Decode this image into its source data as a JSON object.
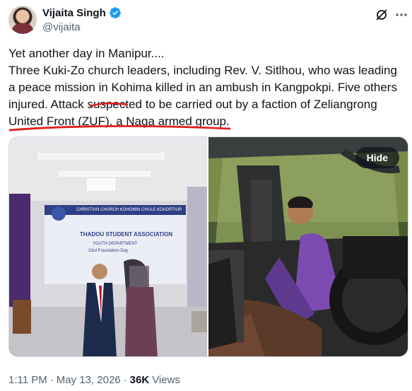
{
  "author": {
    "display_name": "Vijaita Singh",
    "handle": "@vijaita",
    "verified": true
  },
  "icons": {
    "verified": "verified-badge-icon",
    "grok": "grok-slash-icon",
    "more": "more-dots-icon"
  },
  "tweet": {
    "line1": "Yet another day in Manipur....",
    "line2": "Three Kuki-Zo church leaders, including Rev. V. Sitlhou, who was leading a peace mission in Kohima killed in an ambush in Kangpokpi. Five others injured. Attack suspected to be carried out by a faction of Zeliangrong United Front (ZUF), a Naga armed group."
  },
  "media": {
    "hide_label": "Hide",
    "banner_title": "CHRISTIAN CHURCH KOHOMIN CHULE KOADRTIUR",
    "banner_sub": "THADOU STUDENT ASSOCIATION",
    "banner_sub2": "YOUTH DEPARTMENT",
    "banner_sub3": "33rd Foundation Day"
  },
  "meta": {
    "time": "1:11 PM",
    "separator": "·",
    "date": "May 13, 2026",
    "views_count": "36K",
    "views_label": "Views"
  },
  "colors": {
    "text": "#0f1419",
    "secondary": "#536471",
    "verified_blue": "#1d9bf0",
    "annotation_red": "#e0201c"
  }
}
